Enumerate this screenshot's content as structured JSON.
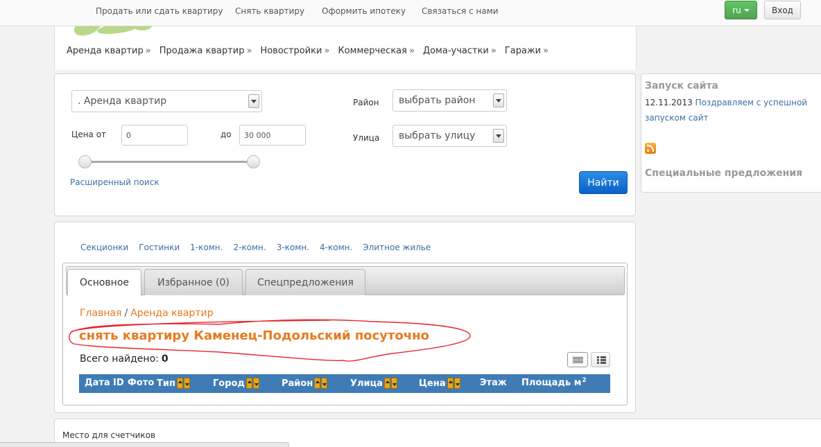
{
  "topnav": [
    "Продать или сдать квартиру",
    "Снять квартиру",
    "Оформить ипотеку",
    "Связаться с нами"
  ],
  "lang": {
    "label": "ru"
  },
  "login": {
    "label": "Вход"
  },
  "catnav": [
    "Аренда квартир",
    "Продажа квартир",
    "Новостройки",
    "Коммерческая",
    "Дома-участки",
    "Гаражи"
  ],
  "catnav_sep": "»",
  "search": {
    "type_select": ". Аренда квартир",
    "price_from_label": "Цена от",
    "price_from": "0",
    "price_to_label": "до",
    "price_to": "30 000",
    "district_label": "Район",
    "district_select": "выбрать район",
    "street_label": "Улица",
    "street_select": "выбрать улицу",
    "advanced_link": "Расширенный поиск",
    "find_button": "Найти",
    "price_range_fraction": [
      0.0,
      1.0
    ]
  },
  "news": {
    "title": "Запуск сайта",
    "date": "12.11.2013",
    "link": "Поздравляем с успешной запуском сайт",
    "special_title": "Специальные предложения"
  },
  "subcats": [
    "Секционки",
    "Гостинки",
    "1-комн.",
    "2-комн.",
    "3-комн.",
    "4-комн.",
    "Элитное жилье"
  ],
  "tabs": [
    {
      "label": "Основное",
      "active": true
    },
    {
      "label": "Избранное (0)",
      "active": false
    },
    {
      "label": "Спецпредложения",
      "active": false
    }
  ],
  "breadcrumb": {
    "home": "Главная",
    "sep": "/",
    "current": "Аренда квартир"
  },
  "page_title": "снять квартиру Каменец-Подольский посуточно",
  "found": {
    "label": "Всего найдено",
    "colon": ":",
    "count": "0"
  },
  "table_headers": {
    "date": "Дата",
    "id": "ID",
    "photo": "Фото",
    "type": "Тип",
    "city": "Город",
    "district": "Район",
    "street": "Улица",
    "price": "Цена",
    "floor": "Этаж",
    "area": "Площадь м",
    "area_sup": "2"
  },
  "footer": {
    "counters": "Место для счетчиков"
  },
  "colors": {
    "accent_orange": "#e87a1e",
    "table_header": "#3f7cb6",
    "link": "#3a6ea5",
    "find_button": "#0a61c7",
    "lang_button": "#51a351",
    "annotation": "#e8262e"
  }
}
